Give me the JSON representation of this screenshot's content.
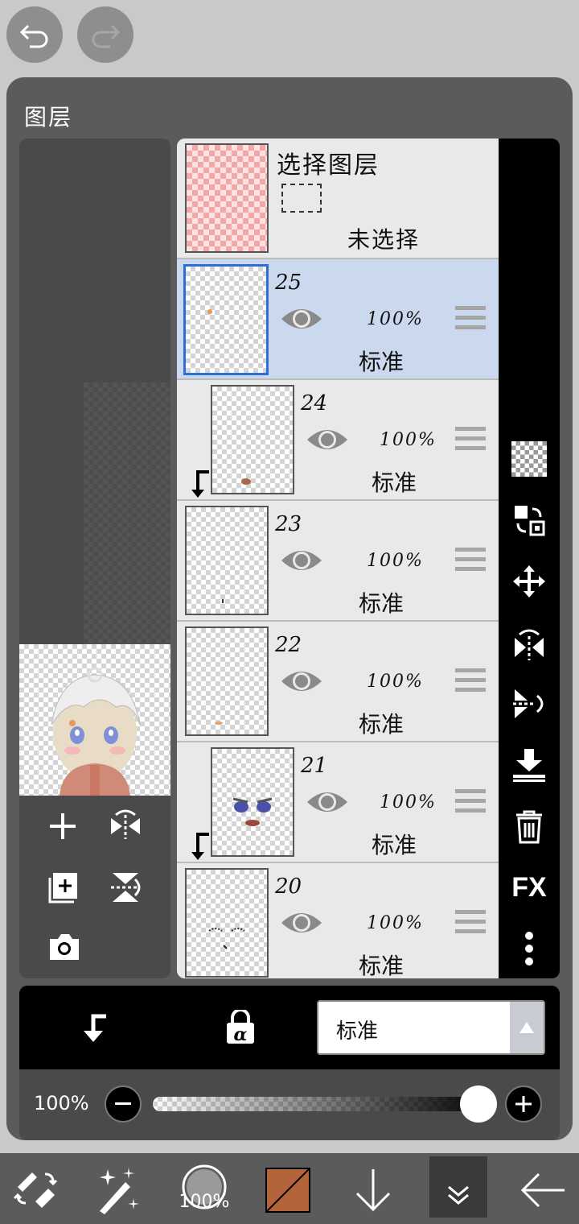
{
  "panel_title": "图层",
  "select_layer": {
    "title": "选择图层",
    "status": "未选择"
  },
  "layers": [
    {
      "name": "25",
      "opacity": "100%",
      "mode": "标准",
      "selected": true,
      "clipped": false
    },
    {
      "name": "24",
      "opacity": "100%",
      "mode": "标准",
      "selected": false,
      "clipped": true
    },
    {
      "name": "23",
      "opacity": "100%",
      "mode": "标准",
      "selected": false,
      "clipped": false
    },
    {
      "name": "22",
      "opacity": "100%",
      "mode": "标准",
      "selected": false,
      "clipped": false
    },
    {
      "name": "21",
      "opacity": "100%",
      "mode": "标准",
      "selected": false,
      "clipped": true
    },
    {
      "name": "20",
      "opacity": "100%",
      "mode": "标准",
      "selected": false,
      "clipped": false
    }
  ],
  "right_tools": [
    "checker-icon",
    "swap-layer-icon",
    "move-icon",
    "flip-horizontal-icon",
    "flip-vertical-icon",
    "merge-down-icon",
    "trash-icon",
    "fx-icon",
    "more-icon"
  ],
  "fx_label": "FX",
  "blend_mode": "标准",
  "opacity_label": "100%",
  "opacity_value": 1.0,
  "toolbar": {
    "brush_size": "100%"
  },
  "colors": {
    "accent": "#2c6fd6",
    "current_color": "#b4643c"
  }
}
